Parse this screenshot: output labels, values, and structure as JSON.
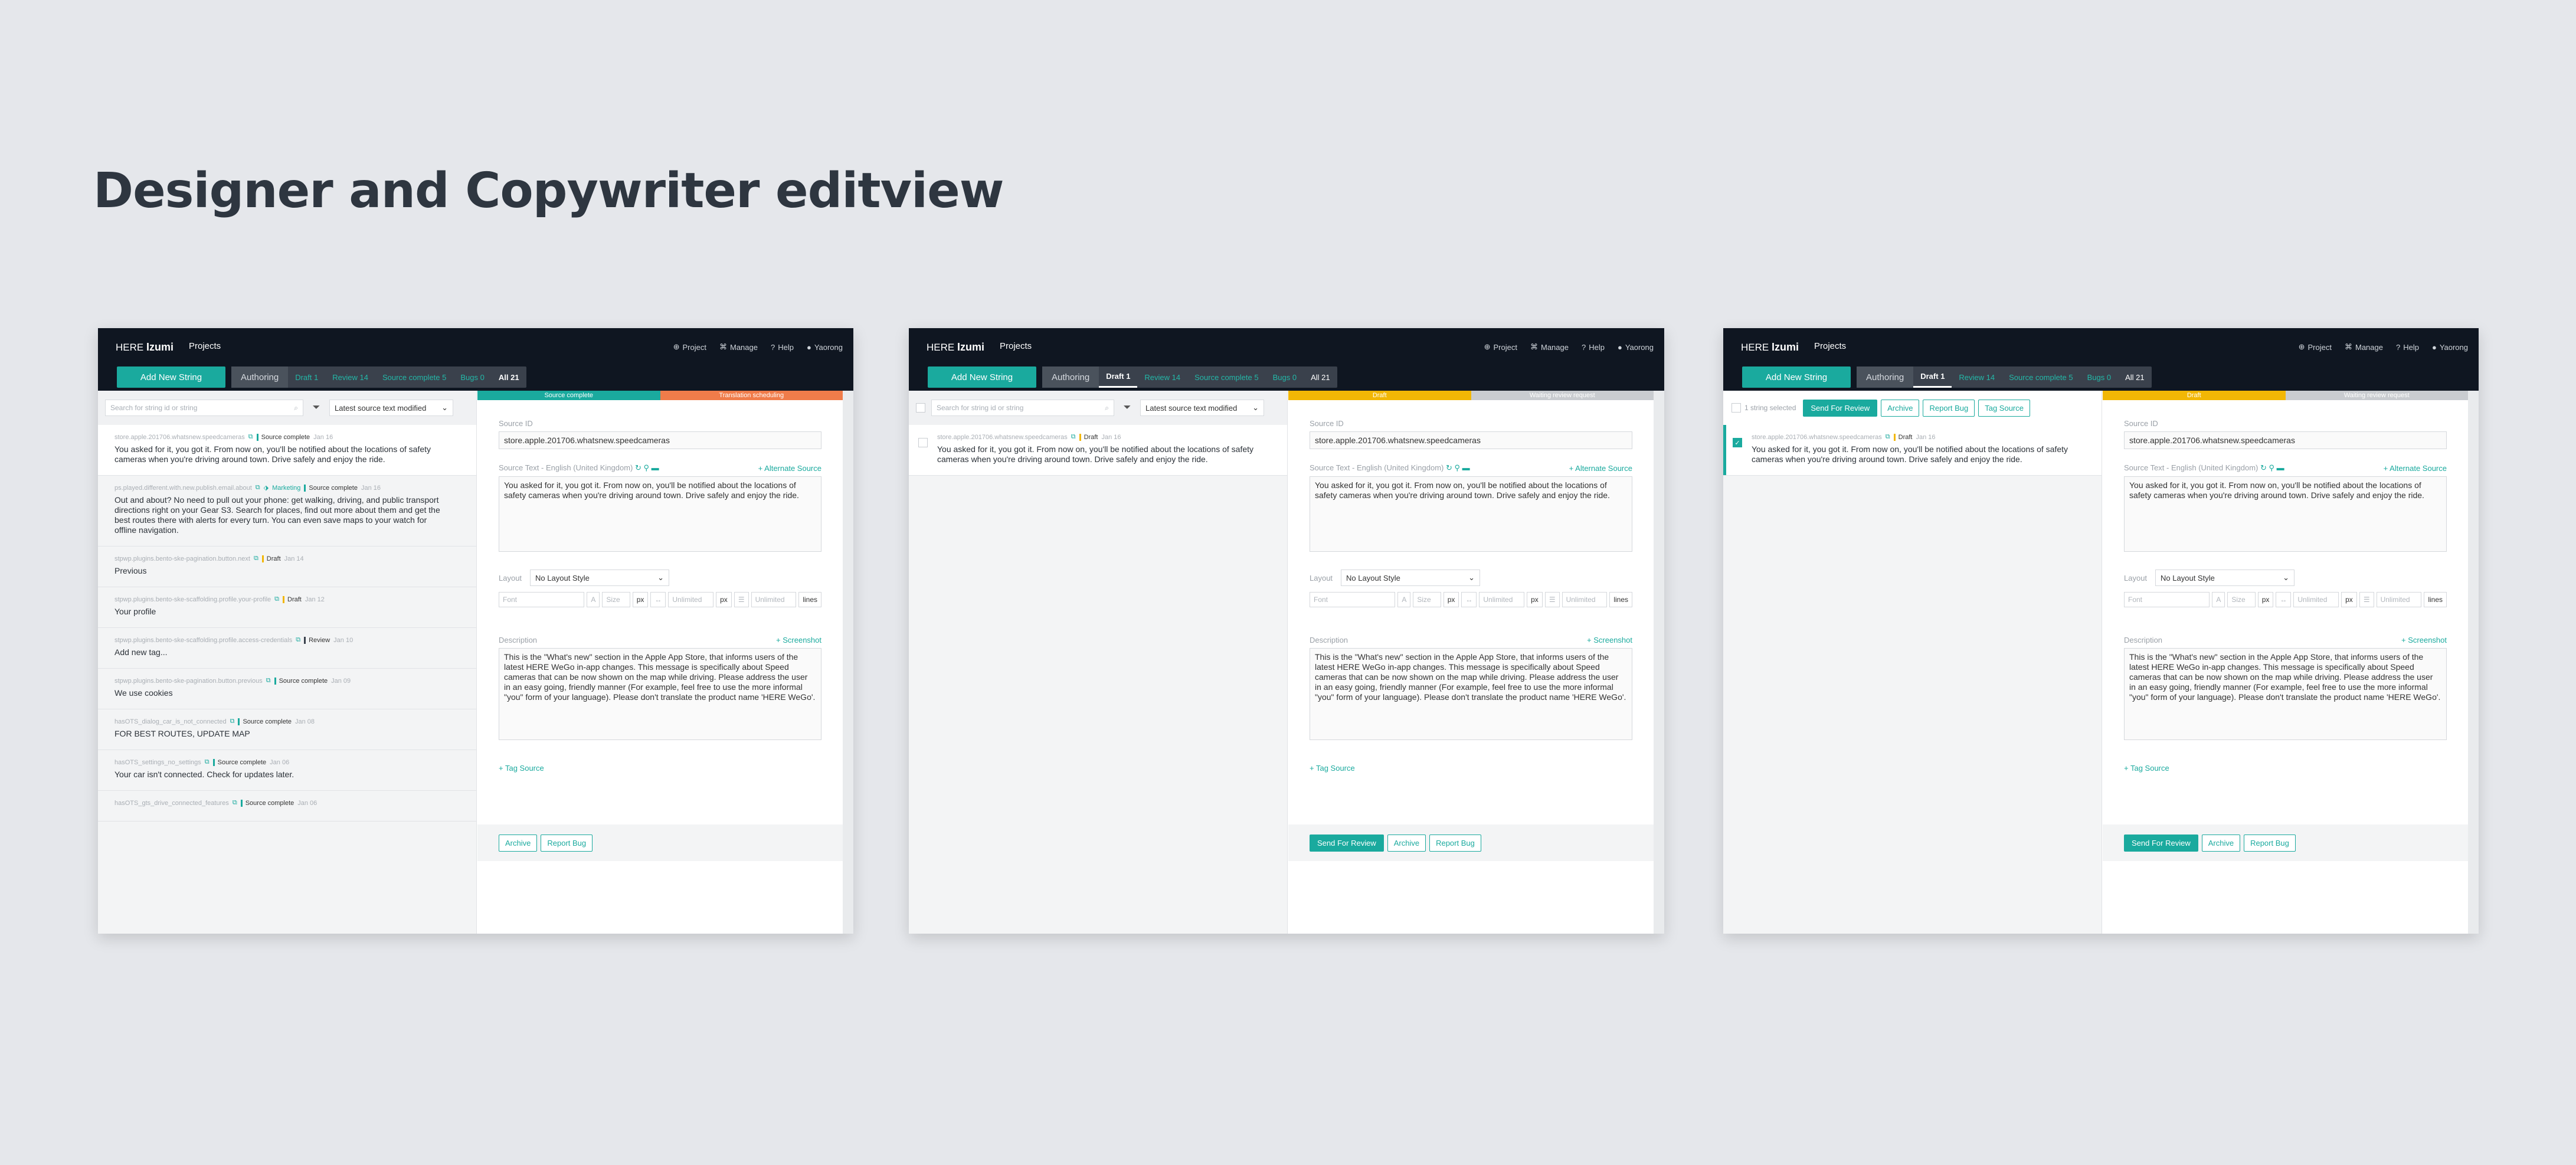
{
  "title": "Designer and Copywriter editview",
  "app": {
    "brand": "HERE",
    "brand_product": "Izumi",
    "nav_projects": "Projects",
    "top_links": [
      "Project",
      "Manage",
      "Help",
      "Yaorong"
    ],
    "add_button": "Add New String",
    "tabs": {
      "authoring": "Authoring",
      "draft": "Draft",
      "draft_count": "1",
      "review": "Review",
      "review_count": "14",
      "source_complete": "Source complete",
      "source_complete_count": "5",
      "bugs": "Bugs",
      "bugs_count": "0",
      "all": "All",
      "all_count": "21"
    },
    "search_placeholder": "Search for string id or string",
    "sort_label": "Latest source text modified",
    "bulk": {
      "count_label": "1 string selected",
      "send_for_review": "Send For Review",
      "archive": "Archive",
      "report_bug": "Report Bug",
      "tag_source": "Tag Source"
    },
    "statusbar": {
      "source_complete": "Source complete",
      "translation_scheduling": "Translation scheduling",
      "draft": "Draft",
      "waiting": "Waiting review request"
    },
    "list": [
      {
        "id": "store.apple.201706.whatsnew.speedcameras",
        "tag": "",
        "status": "Source complete",
        "date": "Jan 16",
        "text": "You asked for it, you got it. From now on, you'll be notified about the locations of safety cameras when you're driving around town. Drive safely and enjoy the ride."
      },
      {
        "id": "ps.played.different.with.new.publish.email.about",
        "tag": "Marketing",
        "status": "Source complete",
        "date": "Jan 16",
        "text": "Out and about? No need to pull out your phone: get walking, driving, and public transport directions right on your Gear S3. Search for places, find out more about them and get the best routes there with alerts for every turn. You can even save maps to your watch for offline navigation."
      },
      {
        "id": "stpwp.plugins.bento-ske-pagination.button.next",
        "tag": "",
        "status": "Draft",
        "date": "Jan 14",
        "text": "Previous"
      },
      {
        "id": "stpwp.plugins.bento-ske-scaffolding.profile.your-profile",
        "tag": "",
        "status": "Draft",
        "date": "Jan 12",
        "text": "Your profile"
      },
      {
        "id": "stpwp.plugins.bento-ske-scaffolding.profile.access-credentials",
        "tag": "",
        "status": "Review",
        "date": "Jan 10",
        "text": "Add new tag..."
      },
      {
        "id": "stpwp.plugins.bento-ske-pagination.button.previous",
        "tag": "",
        "status": "Source complete",
        "date": "Jan 09",
        "text": "We use cookies"
      },
      {
        "id": "hasOTS_dialog_car_is_not_connected",
        "tag": "",
        "status": "Source complete",
        "date": "Jan 08",
        "text": "FOR BEST ROUTES, UPDATE MAP"
      },
      {
        "id": "hasOTS_settings_no_settings",
        "tag": "",
        "status": "Source complete",
        "date": "Jan 06",
        "text": "Your car isn't connected. Check for updates later."
      },
      {
        "id": "hasOTS_gts_drive_connected_features",
        "tag": "",
        "status": "Source complete",
        "date": "Jan 06",
        "text": ""
      }
    ],
    "draft_item": {
      "id": "store.apple.201706.whatsnew.speedcameras",
      "status": "Draft",
      "date": "Jan 16",
      "text": "You asked for it, you got it. From now on, you'll be notified about the locations of safety cameras when you're driving around town. Drive safely and enjoy the ride."
    },
    "form": {
      "source_id_label": "Source ID",
      "source_id": "store.apple.201706.whatsnew.speedcameras",
      "source_text_label": "Source Text - English (United Kingdom)",
      "alternate_source": "+ Alternate Source",
      "source_text": "You asked for it, you got it. From now on, you'll be notified about the locations of safety cameras when you're driving around town. Drive safely and enjoy the ride.",
      "layout_label": "Layout",
      "layout_value": "No Layout Style",
      "font_placeholder": "Font",
      "size_placeholder": "Size",
      "px": "px",
      "unlimited": "Unlimited",
      "lines": "lines",
      "description_label": "Description",
      "screenshot": "+ Screenshot",
      "description": "This is the \"What's new\" section in the Apple App Store, that informs users of the latest HERE WeGo in-app changes. This message is specifically about Speed cameras that can be now shown on the map while driving. Please address the user in an easy going, friendly manner (For example, feel free to use the more informal \"you\" form of your language). Please don't translate the product name 'HERE WeGo'.",
      "tag_source": "+ Tag Source"
    },
    "footer": {
      "send_for_review": "Send For Review",
      "archive": "Archive",
      "report_bug": "Report Bug"
    }
  },
  "colors": {
    "accent": "#1aaa9e",
    "topbar": "#0f1621",
    "orange": "#f07c4a",
    "yellow": "#f2b705"
  }
}
